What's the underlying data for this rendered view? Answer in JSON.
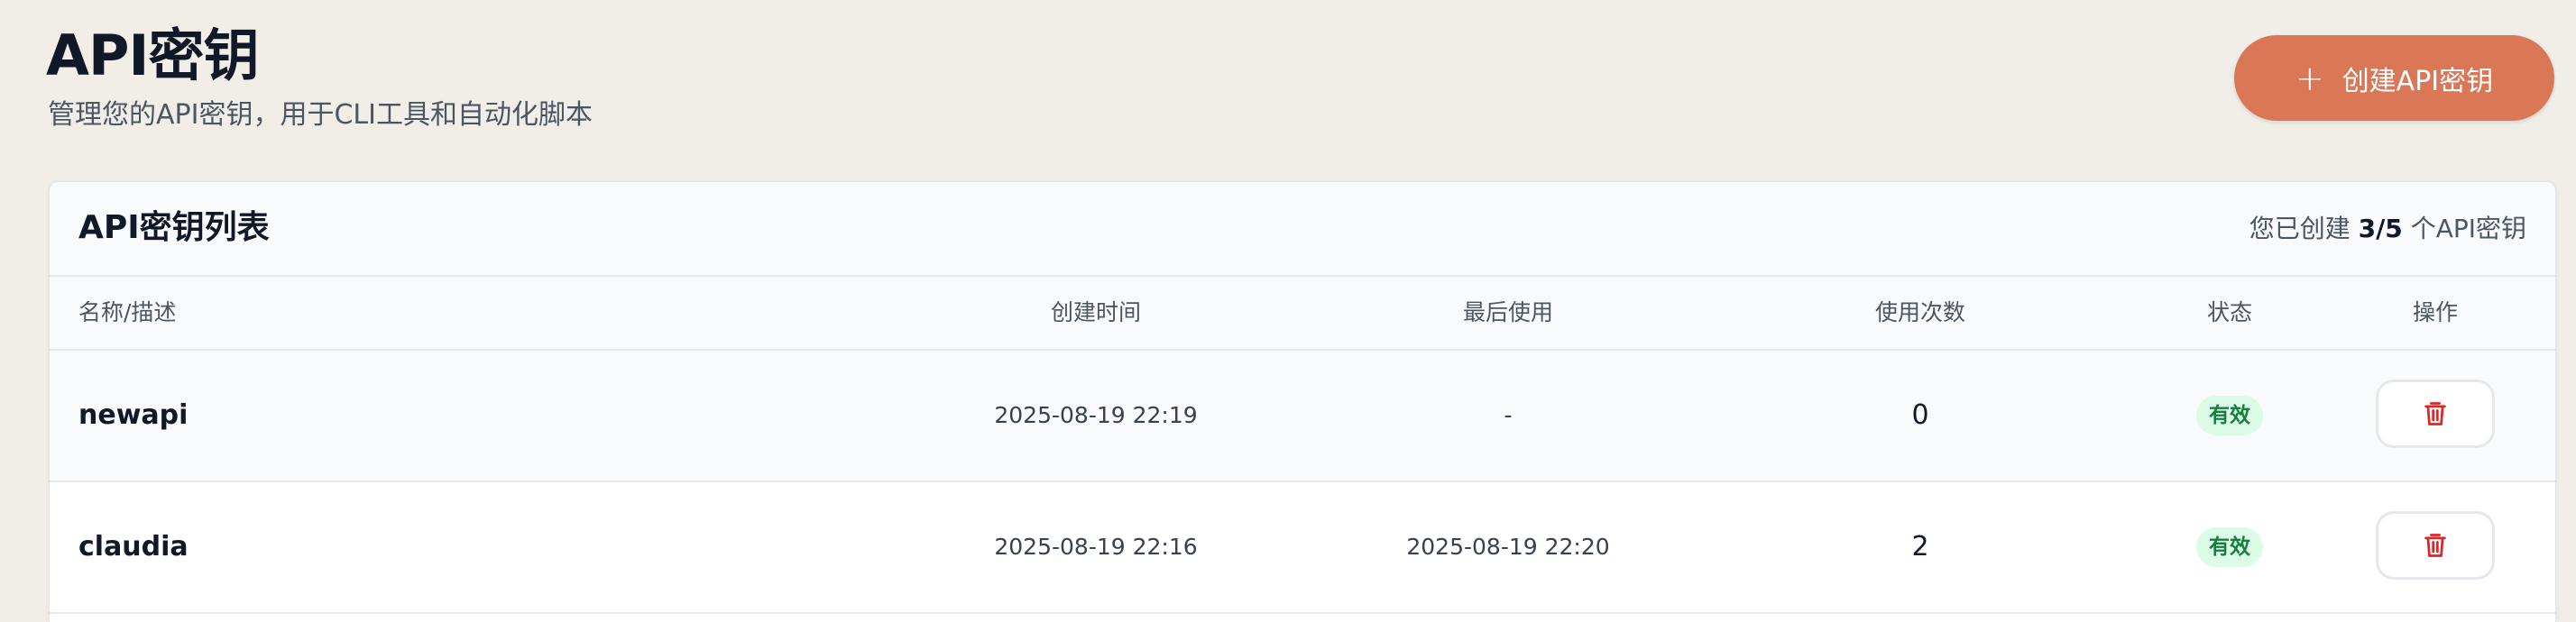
{
  "header": {
    "title": "API密钥",
    "subtitle": "管理您的API密钥，用于CLI工具和自动化脚本",
    "create_button_label": "创建API密钥",
    "create_button_icon": "plus-icon"
  },
  "card": {
    "title": "API密钥列表",
    "count_prefix": "您已创建 ",
    "count_value": "3/5",
    "count_suffix": " 个API密钥"
  },
  "table": {
    "columns": [
      "名称/描述",
      "创建时间",
      "最后使用",
      "使用次数",
      "状态",
      "操作"
    ],
    "rows": [
      {
        "name": "newapi",
        "created": "2025-08-19 22:19",
        "last_used": "-",
        "uses": "0",
        "status": "有效",
        "action_icon": "trash-icon"
      },
      {
        "name": "claudia",
        "created": "2025-08-19 22:16",
        "last_used": "2025-08-19 22:20",
        "uses": "2",
        "status": "有效",
        "action_icon": "trash-icon"
      }
    ]
  },
  "colors": {
    "background": "#f0eee7",
    "accent": "#d97757",
    "active_badge_bg": "#dcfce7",
    "active_badge_text": "#15803d",
    "delete_icon": "#dc2626"
  }
}
